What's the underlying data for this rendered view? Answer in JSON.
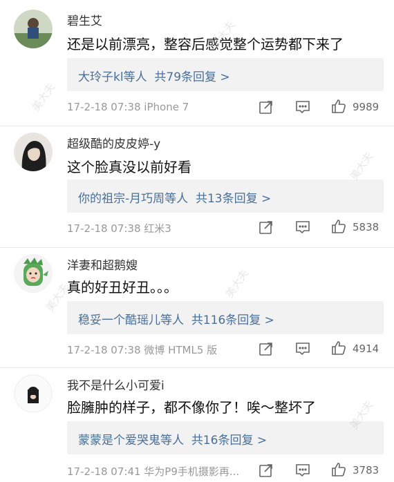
{
  "comments": [
    {
      "username": "碧生艾",
      "text": "还是以前漂亮，整容后感觉整个运势都下来了",
      "reply_people": "大玲子kl等人",
      "reply_count": "共79条回复 >",
      "meta": "17-2-18 07:38  iPhone 7",
      "likes": "9989",
      "avatar_color": "#6e8f6a"
    },
    {
      "username": "超级酷的皮皮婷-y",
      "text": "这个脸真没以前好看",
      "reply_people": "你的祖宗-月巧周等人",
      "reply_count": "共13条回复 >",
      "meta": "17-2-18 07:38  红米3",
      "likes": "5838",
      "avatar_color": "#3a3a3a"
    },
    {
      "username": "洋妻和超鹅嫂",
      "text": "真的好丑好丑。。。",
      "reply_people": "稳妥一个酷瑶儿等人",
      "reply_count": "共116条回复 >",
      "meta": "17-2-18 07:38  微博 HTML5 版",
      "likes": "4914",
      "avatar_color": "#5aa05a"
    },
    {
      "username": "我不是什么小可爱i",
      "text": "脸臃肿的样子，都不像你了！唉～整坏了",
      "reply_people": "蒙蒙是个爱哭鬼等人",
      "reply_count": "共16条回复 >",
      "meta": "17-2-18 07:41  华为P9手机摄影再...",
      "likes": "3783",
      "avatar_color": "#222222"
    }
  ],
  "watermark": "美大夫"
}
